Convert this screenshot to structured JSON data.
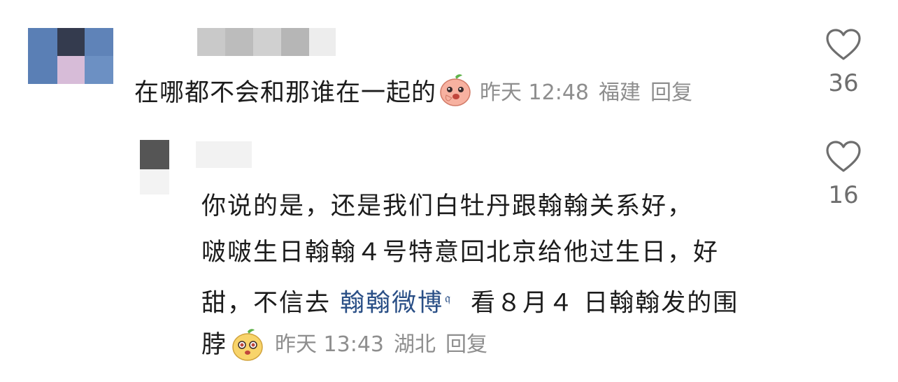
{
  "colors": {
    "link": "#2a4f86",
    "meta": "#8e8e8e",
    "text": "#1c1c1c",
    "count": "#6e6e6e"
  },
  "comment": {
    "text": "在哪都不会和那谁在一起的",
    "emoji": "peach-face-emoji",
    "time": "昨天 12:48",
    "location": "福建",
    "reply_label": "回复",
    "likes": "36"
  },
  "reply": {
    "line1": "你说的是，还是我们白牡丹跟翰翰关系好，",
    "line2": "啵啵生日翰翰４号特意回北京给他过生日，好",
    "line3_prefix": "甜，不信去 ",
    "link": "翰翰微博",
    "line3_suffix": " 看８月４ 日翰翰发的围",
    "line4": "脖",
    "emoji": "yellow-face-emoji",
    "time": "昨天 13:43",
    "location": "湖北",
    "reply_label": "回复",
    "likes": "16"
  }
}
